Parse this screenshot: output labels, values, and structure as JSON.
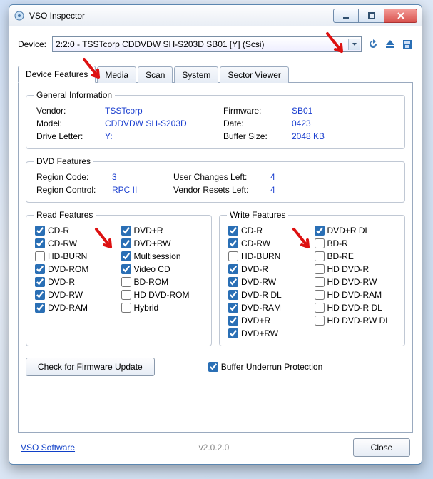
{
  "window": {
    "title": "VSO Inspector"
  },
  "device": {
    "label": "Device:",
    "selected": "2:2:0 - TSSTcorp CDDVDW SH-S203D SB01 [Y] (Scsi)"
  },
  "tabs": [
    "Device Features",
    "Media",
    "Scan",
    "System",
    "Sector Viewer"
  ],
  "general": {
    "legend": "General Information",
    "vendor_k": "Vendor:",
    "vendor_v": "TSSTcorp",
    "model_k": "Model:",
    "model_v": "CDDVDW SH-S203D",
    "drive_k": "Drive Letter:",
    "drive_v": "Y:",
    "fw_k": "Firmware:",
    "fw_v": "SB01",
    "date_k": "Date:",
    "date_v": "0423",
    "buf_k": "Buffer Size:",
    "buf_v": "2048 KB"
  },
  "dvd": {
    "legend": "DVD Features",
    "region_code_k": "Region Code:",
    "region_code_v": "3",
    "region_ctrl_k": "Region Control:",
    "region_ctrl_v": "RPC II",
    "user_changes_k": "User Changes Left:",
    "user_changes_v": "4",
    "vendor_resets_k": "Vendor Resets Left:",
    "vendor_resets_v": "4"
  },
  "read": {
    "legend": "Read Features",
    "col1": [
      {
        "label": "CD-R",
        "checked": true
      },
      {
        "label": "CD-RW",
        "checked": true
      },
      {
        "label": "HD-BURN",
        "checked": false
      },
      {
        "label": "DVD-ROM",
        "checked": true
      },
      {
        "label": "DVD-R",
        "checked": true
      },
      {
        "label": "DVD-RW",
        "checked": true
      },
      {
        "label": "DVD-RAM",
        "checked": true
      }
    ],
    "col2": [
      {
        "label": "DVD+R",
        "checked": true
      },
      {
        "label": "DVD+RW",
        "checked": true
      },
      {
        "label": "Multisession",
        "checked": true
      },
      {
        "label": "Video CD",
        "checked": true
      },
      {
        "label": "BD-ROM",
        "checked": false
      },
      {
        "label": "HD DVD-ROM",
        "checked": false
      },
      {
        "label": "Hybrid",
        "checked": false
      }
    ]
  },
  "write": {
    "legend": "Write Features",
    "col1": [
      {
        "label": "CD-R",
        "checked": true
      },
      {
        "label": "CD-RW",
        "checked": true
      },
      {
        "label": "HD-BURN",
        "checked": false
      },
      {
        "label": "DVD-R",
        "checked": true
      },
      {
        "label": "DVD-RW",
        "checked": true
      },
      {
        "label": "DVD-R DL",
        "checked": true
      },
      {
        "label": "DVD-RAM",
        "checked": true
      },
      {
        "label": "DVD+R",
        "checked": true
      },
      {
        "label": "DVD+RW",
        "checked": true
      }
    ],
    "col2": [
      {
        "label": "DVD+R DL",
        "checked": true
      },
      {
        "label": "BD-R",
        "checked": false
      },
      {
        "label": "BD-RE",
        "checked": false
      },
      {
        "label": "HD DVD-R",
        "checked": false
      },
      {
        "label": "HD DVD-RW",
        "checked": false
      },
      {
        "label": "HD DVD-RAM",
        "checked": false
      },
      {
        "label": "HD DVD-R DL",
        "checked": false
      },
      {
        "label": "HD DVD-RW DL",
        "checked": false
      }
    ],
    "buffer_underrun": {
      "label": "Buffer Underrun Protection",
      "checked": true
    }
  },
  "firmware_button": "Check for Firmware Update",
  "footer": {
    "link": "VSO Software",
    "version": "v2.0.2.0",
    "close": "Close"
  }
}
